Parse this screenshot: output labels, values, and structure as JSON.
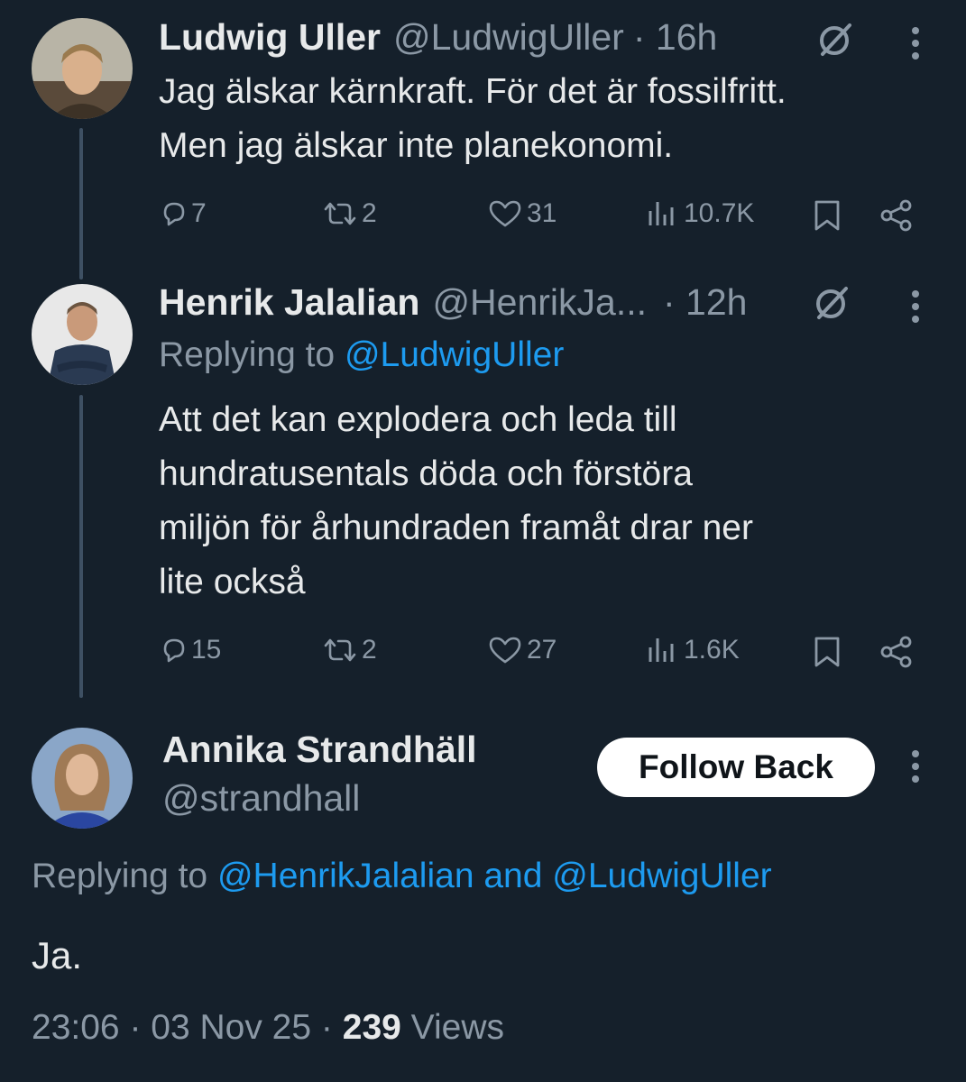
{
  "tweets": [
    {
      "name": "Ludwig Uller",
      "handle": "@LudwigUller",
      "time": "· 16h",
      "lines": [
        "Jag älskar kärnkraft. För det är fossilfritt.",
        "Men jag älskar inte planekonomi."
      ],
      "replies": "7",
      "reposts": "2",
      "likes": "31",
      "views": "10.7K"
    },
    {
      "name": "Henrik Jalalian",
      "handle": "@HenrikJa...",
      "time": "· 12h",
      "replying_prefix": "Replying to",
      "replying_to": "@LudwigUller",
      "lines": [
        "Att det kan explodera och leda till",
        "hundratusentals döda och förstöra",
        "miljön för århundraden framåt drar ner",
        "lite också"
      ],
      "replies": "15",
      "reposts": "2",
      "likes": "27",
      "views": "1.6K"
    }
  ],
  "main": {
    "name": "Annika Strandhäll",
    "handle": "@strandhall",
    "follow_label": "Follow Back",
    "replying_prefix": "Replying to",
    "replying_to_1": "@HenrikJalalian",
    "replying_and": "and",
    "replying_to_2": "@LudwigUller",
    "text": "Ja.",
    "time": "23:06",
    "date": "03 Nov 25",
    "views_count": "239",
    "views_label": "Views"
  },
  "colors": {
    "background": "#15202b",
    "link": "#1d9bf0",
    "muted": "#8b98a5",
    "text": "#e7e9ea",
    "thread_line": "#3e5063"
  },
  "icons": [
    "reply-icon",
    "repost-icon",
    "like-icon",
    "views-icon",
    "bookmark-icon",
    "share-icon",
    "grok-icon",
    "more-icon"
  ]
}
